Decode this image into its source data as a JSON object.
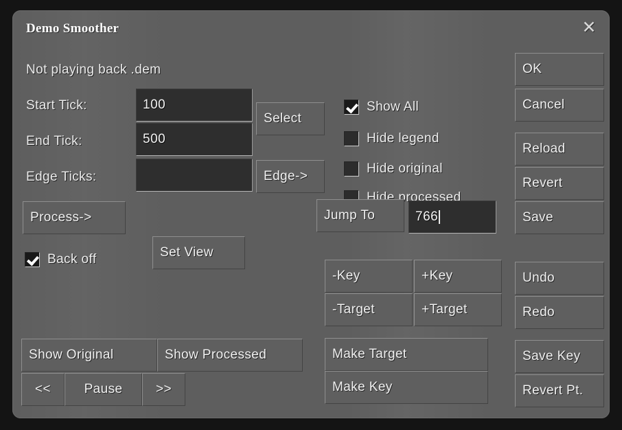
{
  "window": {
    "title": "Demo Smoother",
    "close_icon": "close-icon",
    "close_glyph": "✕"
  },
  "status": {
    "text": "Not playing back .dem"
  },
  "colors": {
    "panel_bg": "#5e5e5e",
    "button_bg": "#5f5f5f",
    "field_bg": "#2e2e2e",
    "text": "#eaeaea",
    "backdrop": "#141414"
  },
  "tick_fields": [
    {
      "label": "Start Tick:",
      "value": "100",
      "placeholder": ""
    },
    {
      "label": "End Tick:",
      "value": "500",
      "placeholder": ""
    },
    {
      "label": "Edge Ticks:",
      "value": "",
      "placeholder": ""
    }
  ],
  "side_buttons": {
    "select": "Select",
    "edge": "Edge->"
  },
  "process": {
    "process_label": "Process->",
    "set_view_label": "Set View",
    "back_off": {
      "label": "Back off",
      "checked": true
    }
  },
  "view_options": [
    {
      "label": "Show All",
      "checked": true
    },
    {
      "label": "Hide legend",
      "checked": false
    },
    {
      "label": "Hide original",
      "checked": false
    },
    {
      "label": "Hide processed",
      "checked": false
    }
  ],
  "jump": {
    "button_label": "Jump To",
    "value": "766"
  },
  "key_target": {
    "minus_key": "-Key",
    "plus_key": "+Key",
    "minus_target": "-Target",
    "plus_target": "+Target",
    "make_target": "Make Target",
    "make_key": "Make Key"
  },
  "playback": {
    "show_original": "Show Original",
    "show_processed": "Show Processed",
    "rewind": "<<",
    "pause": "Pause",
    "forward": ">>"
  },
  "right_column": {
    "ok": "OK",
    "cancel": "Cancel",
    "reload": "Reload",
    "revert": "Revert",
    "save": "Save",
    "undo": "Undo",
    "redo": "Redo",
    "save_key": "Save Key",
    "revert_pt": "Revert Pt."
  }
}
